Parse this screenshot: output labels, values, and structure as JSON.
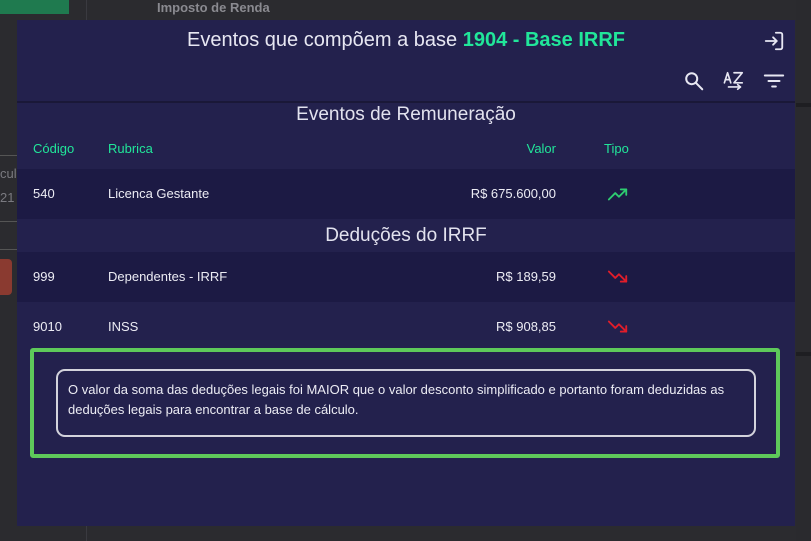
{
  "background": {
    "title": "Imposto de Renda",
    "left_fragment_1": "cula",
    "left_fragment_2": "21"
  },
  "modal": {
    "title_prefix": "Eventos que compõem a base ",
    "title_accent": "1904 - Base IRRF",
    "toolbar": {
      "exit_icon": "exit-icon",
      "search_icon": "search-icon",
      "sort_icon": "sort-az-icon",
      "filter_icon": "filter-icon"
    },
    "columns": {
      "codigo": "Código",
      "rubrica": "Rubrica",
      "valor": "Valor",
      "tipo": "Tipo"
    },
    "remuneracao": {
      "title": "Eventos de Remuneração",
      "rows": [
        {
          "codigo": "540",
          "rubrica": "Licenca Gestante",
          "valor": "R$ 675.600,00",
          "tipo": "trending-up-icon"
        }
      ]
    },
    "deducoes": {
      "title": "Deduções do IRRF",
      "rows": [
        {
          "codigo": "999",
          "rubrica": "Dependentes - IRRF",
          "valor": "R$ 189,59",
          "tipo": "trending-down-icon"
        },
        {
          "codigo": "9010",
          "rubrica": "INSS",
          "valor": "R$ 908,85",
          "tipo": "trending-down-icon"
        }
      ]
    },
    "info_message": "O valor da soma das deduções legais foi MAIOR que o valor desconto simplificado e portanto foram deduzidas as deduções legais para encontrar a base de cálculo.",
    "colors": {
      "accent": "#21e69a",
      "up": "#2ecc71",
      "down": "#e11d2a",
      "highlight": "#5ec95a"
    }
  }
}
